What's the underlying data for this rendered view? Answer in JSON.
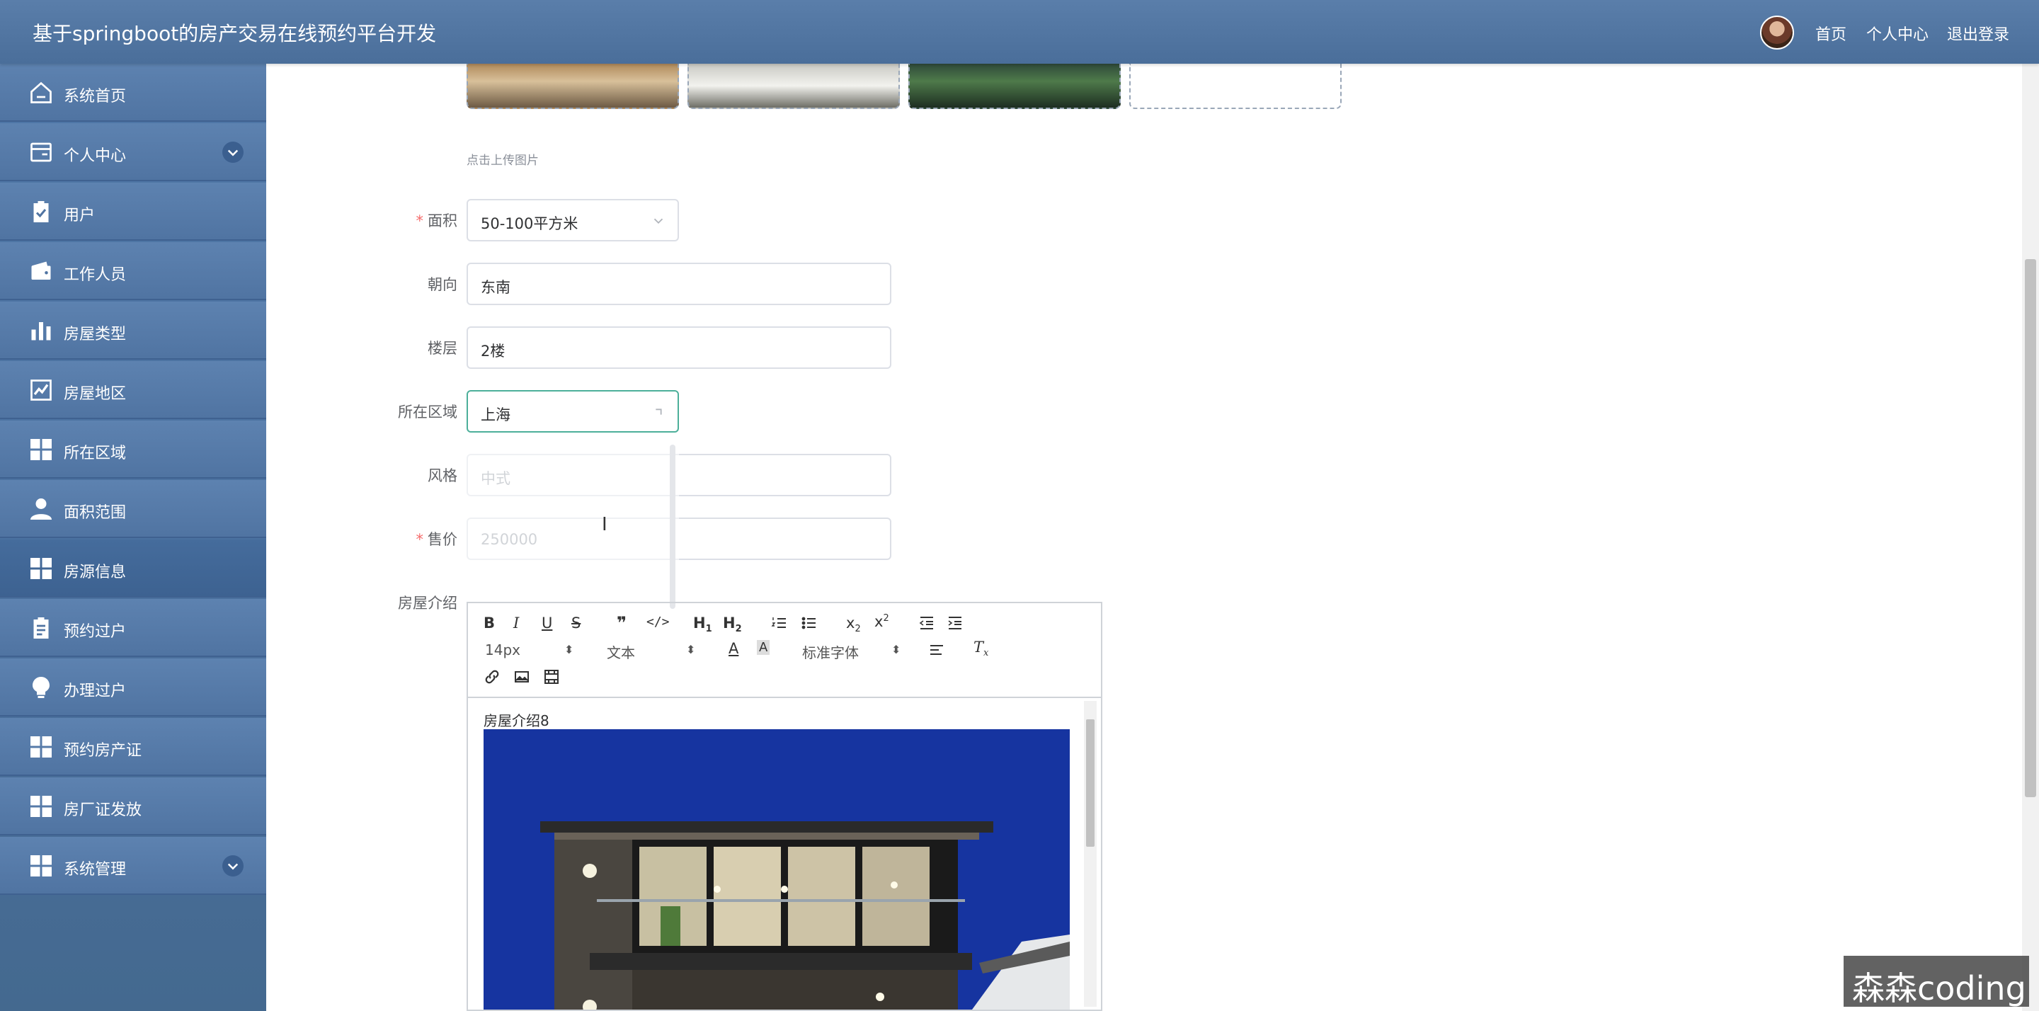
{
  "header": {
    "title": "基于springboot的房产交易在线预约平台开发",
    "nav": [
      "首页",
      "个人中心",
      "退出登录"
    ]
  },
  "sidebar": {
    "items": [
      {
        "label": "系统首页",
        "icon": "home-icon"
      },
      {
        "label": "个人中心",
        "icon": "card-icon",
        "expandable": true
      },
      {
        "label": "用户",
        "icon": "clipboard-check-icon"
      },
      {
        "label": "工作人员",
        "icon": "wallet-icon"
      },
      {
        "label": "房屋类型",
        "icon": "bar-chart-icon"
      },
      {
        "label": "房屋地区",
        "icon": "line-chart-icon"
      },
      {
        "label": "所在区域",
        "icon": "grid-icon"
      },
      {
        "label": "面积范围",
        "icon": "user-icon"
      },
      {
        "label": "房源信息",
        "icon": "grid-icon",
        "active": true
      },
      {
        "label": "预约过户",
        "icon": "clipboard-icon"
      },
      {
        "label": "办理过户",
        "icon": "bulb-icon"
      },
      {
        "label": "预约房产证",
        "icon": "grid-icon"
      },
      {
        "label": "房厂证发放",
        "icon": "grid-icon"
      },
      {
        "label": "系统管理",
        "icon": "grid-icon",
        "expandable": true
      }
    ]
  },
  "form": {
    "upload_hint": "点击上传图片",
    "area": {
      "label": "面积",
      "value": "50-100平方米"
    },
    "orientation": {
      "label": "朝向",
      "value": "东南"
    },
    "floor": {
      "label": "楼层",
      "value": "2楼"
    },
    "region": {
      "label": "所在区域",
      "value": "上海"
    },
    "style": {
      "label": "风格",
      "value": "中式"
    },
    "price": {
      "label": "售价",
      "value": "250000"
    },
    "intro": {
      "label": "房屋介绍"
    }
  },
  "editor": {
    "font_size": "14px",
    "text_type": "文本",
    "font_family": "标准字体",
    "content_text": "房屋介绍8"
  },
  "watermark": "森森coding",
  "colors": {
    "header": "#5a7eaa",
    "sidebar": "#5074a2",
    "focus_border": "#4caf9a",
    "required": "#f56c6c"
  }
}
